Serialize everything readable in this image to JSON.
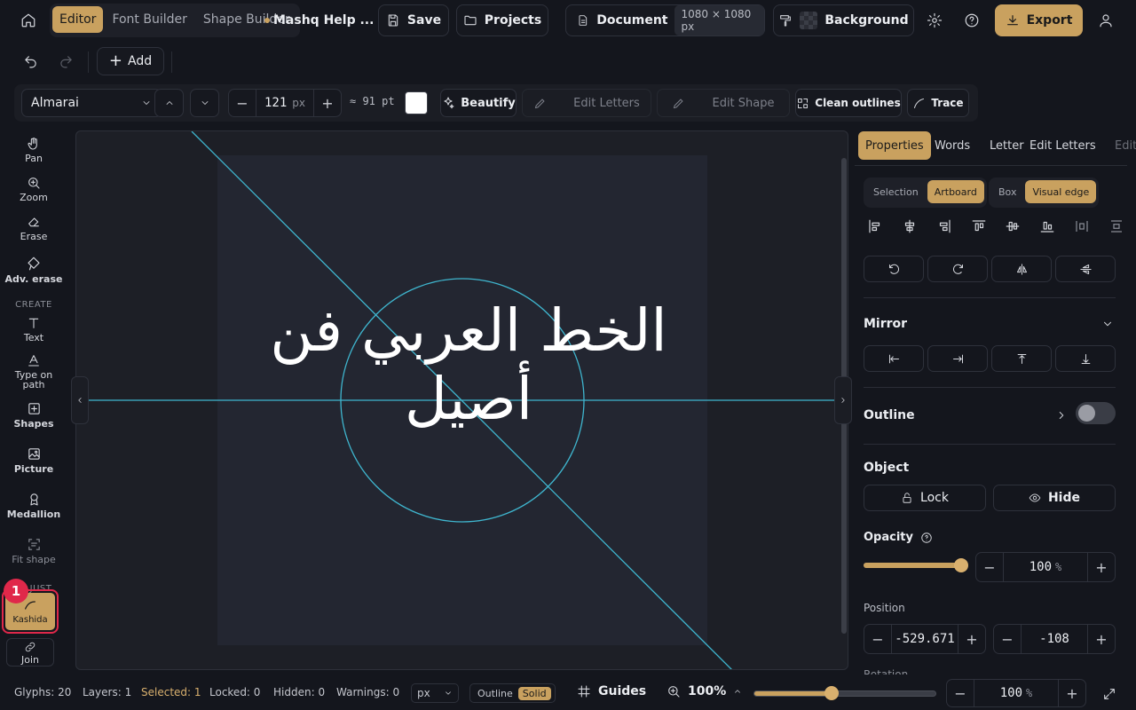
{
  "topbar": {
    "tabs": [
      {
        "label": "Editor",
        "active": true
      },
      {
        "label": "Font Builder",
        "active": false
      },
      {
        "label": "Shape Builder",
        "active": false
      }
    ],
    "help_label": "Mashq Help ...",
    "save_label": "Save",
    "projects_label": "Projects",
    "document_label": "Document",
    "document_size": "1080 × 1080 px",
    "background_label": "Background",
    "export_label": "Export"
  },
  "row2": {
    "add_label": "Add"
  },
  "fontbar": {
    "font_name": "Almarai",
    "size_value": "121",
    "size_unit": "px",
    "pt_approx": "≈ 91 pt",
    "color": "#ffffff",
    "beautify_label": "Beautify",
    "edit_letters_label": "Edit Letters",
    "edit_shape_label": "Edit Shape",
    "clean_outlines_label": "Clean outlines",
    "trace_label": "Trace"
  },
  "tools": {
    "items": [
      {
        "label": "Pan",
        "icon": "hand-icon"
      },
      {
        "label": "Zoom",
        "icon": "zoom-icon"
      },
      {
        "label": "Erase",
        "icon": "eraser-icon"
      },
      {
        "label": "Adv. erase",
        "icon": "adv-eraser-icon"
      }
    ],
    "create_label": "CREATE",
    "create_items": [
      {
        "label": "Text",
        "icon": "text-icon"
      },
      {
        "label": "Type on path",
        "icon": "type-on-path-icon"
      },
      {
        "label": "Shapes",
        "icon": "shapes-icon"
      },
      {
        "label": "Picture",
        "icon": "picture-icon"
      },
      {
        "label": "Medallion",
        "icon": "medallion-icon"
      },
      {
        "label": "Fit shape",
        "icon": "fit-shape-icon"
      }
    ],
    "adjust_label": "JUST",
    "kashida_label": "Kashida",
    "kashida_badge": "1",
    "join_label": "Join"
  },
  "canvas": {
    "text": "الخط العربي فن أصيل",
    "accent": "#3fb6cf"
  },
  "panel": {
    "tabs": [
      "Properties",
      "Words",
      "Letter",
      "Edit Letters",
      "Edit"
    ],
    "selection_label": "Selection",
    "artboard_label": "Artboard",
    "box_label": "Box",
    "visual_edge_label": "Visual edge",
    "mirror_label": "Mirror",
    "outline_label": "Outline",
    "object_label": "Object",
    "lock_label": "Lock",
    "hide_label": "Hide",
    "opacity_label": "Opacity",
    "opacity_value": "100",
    "opacity_unit": "%",
    "opacity_fraction": 1.0,
    "position_label": "Position",
    "pos_x": "-529.671",
    "pos_y": "-108",
    "rotation_label": "Rotation"
  },
  "status": {
    "glyphs": "Glyphs: 20",
    "layers": "Layers: 1",
    "selected": "Selected: 1",
    "locked": "Locked: 0",
    "hidden": "Hidden: 0",
    "warnings": "Warnings: 0",
    "unit": "px",
    "outline_label": "Outline",
    "solid_label": "Solid",
    "guides_label": "Guides",
    "zoom": "100%",
    "zoom_fraction": 0.5,
    "zoom_value": "100",
    "zoom_unit": "%"
  },
  "colors": {
    "accent": "#c9a15f",
    "guide": "#3fb6cf",
    "badge": "#e0284a"
  }
}
